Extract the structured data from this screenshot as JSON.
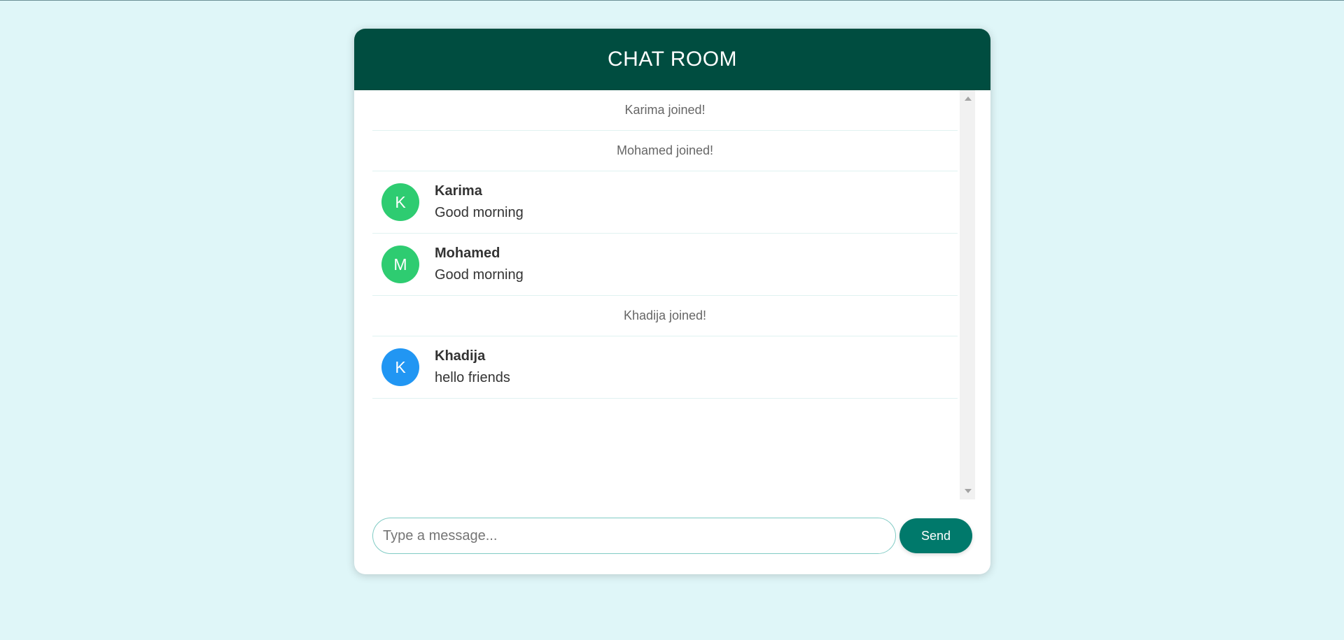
{
  "header": {
    "title": "CHAT ROOM"
  },
  "colors": {
    "page_background": "#dff6f8",
    "header_background": "#004d40",
    "send_button": "#00796b",
    "avatar_green": "#2ecc71",
    "avatar_blue": "#2196f3"
  },
  "messages": [
    {
      "type": "system",
      "text": "Karima joined!"
    },
    {
      "type": "system",
      "text": "Mohamed joined!"
    },
    {
      "type": "user",
      "initial": "K",
      "name": "Karima",
      "text": "Good morning",
      "avatar_color": "#2ecc71"
    },
    {
      "type": "user",
      "initial": "M",
      "name": "Mohamed",
      "text": "Good morning",
      "avatar_color": "#2ecc71"
    },
    {
      "type": "system",
      "text": "Khadija joined!"
    },
    {
      "type": "user",
      "initial": "K",
      "name": "Khadija",
      "text": "hello friends",
      "avatar_color": "#2196f3"
    }
  ],
  "composer": {
    "placeholder": "Type a message...",
    "value": "",
    "send_label": "Send"
  }
}
